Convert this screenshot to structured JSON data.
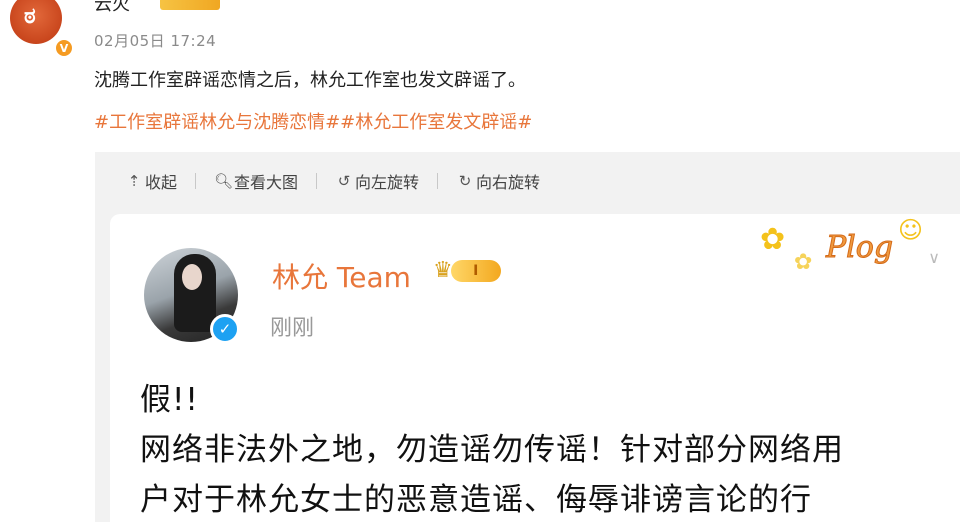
{
  "post": {
    "username": "云火",
    "timestamp": "02月05日 17:24",
    "text": "沈腾工作室辟谣恋情之后，林允工作室也发文辟谣了。",
    "hashtags": "#工作室辟谣林允与沈腾恋情##林允工作室发文辟谣#"
  },
  "toolbar": {
    "collapse": "收起",
    "view_large": "查看大图",
    "rotate_left": "向左旋转",
    "rotate_right": "向右旋转"
  },
  "inner_post": {
    "name": "林允 Team",
    "level": "I",
    "time": "刚刚",
    "sticker_word": "Plog",
    "lines": [
      "假!!",
      "网络非法外之地，勿造谣勿传谣！针对部分网络用",
      "户对于林允女士的恶意造谣、侮辱诽谤言论的行"
    ]
  },
  "icons": {
    "collapse": "arrow-up-icon",
    "view_large": "magnifier-icon",
    "rotate_left": "rotate-left-icon",
    "rotate_right": "rotate-right-icon"
  },
  "colors": {
    "accent": "#e8763b",
    "verified_blue": "#1da1f2",
    "badge_gold": "#f3a81f"
  }
}
